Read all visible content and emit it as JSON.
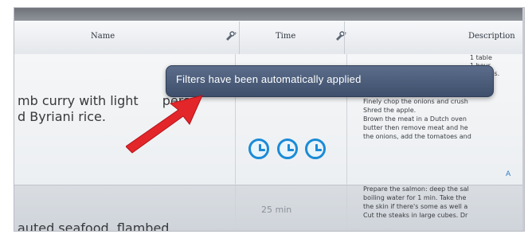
{
  "table": {
    "header": {
      "name": "Name",
      "time": "Time",
      "description": "Description"
    },
    "rows": [
      {
        "name_line1": "mb curry with light",
        "name_line1_tail": "pers",
        "name_line2": "d Byriani rice.",
        "description_lines": [
          "Finely chop the onions and crush",
          "Shred the apple.",
          "Brown the meat in a Dutch oven",
          "butter then remove meat and he",
          "the onions, add the tomatoes and"
        ],
        "description_top_fragments": [
          "1 table",
          "1 hour.",
          "omatoes."
        ],
        "link_hint": "A"
      },
      {
        "duration": "25 min",
        "name_line1": "auted seafood, flambed",
        "description_lines": [
          "Prepare the salmon: deep the sal",
          "boiling water for 1 min. Take the",
          "the skin if there's some as well a",
          "Cut the steaks in large cubes. Dr"
        ]
      }
    ]
  },
  "toast": {
    "message": "Filters have been automatically applied"
  },
  "icons": {
    "filter": "filter-wrench-icon",
    "clock": "clock-icon",
    "arrow": "red-arrow-annotation"
  },
  "colors": {
    "toast_bg": "#4a5b78",
    "clock_blue": "#1b8bd6",
    "arrow_red": "#e3262a"
  }
}
